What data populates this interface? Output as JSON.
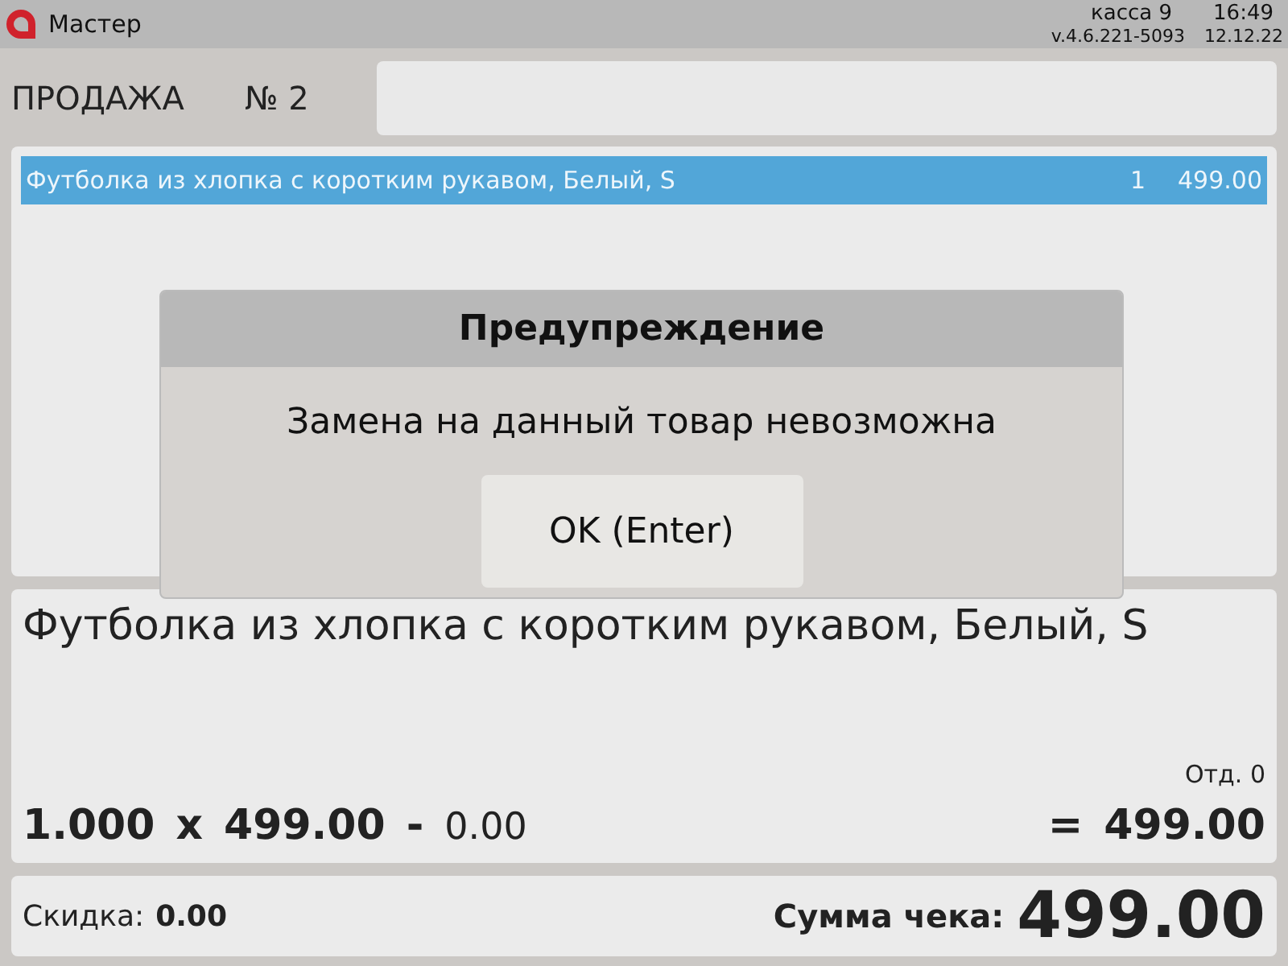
{
  "top_bar": {
    "app_name": "Мастер",
    "register": "касса 9",
    "time": "16:49",
    "version": "v.4.6.221-5093",
    "date": "12.12.22"
  },
  "sale": {
    "title": "ПРОДАЖА",
    "number": "№ 2"
  },
  "receipt_rows": [
    {
      "name": "Футболка из хлопка с коротким рукавом, Белый, S",
      "quantity": "1",
      "price": "499.00",
      "selected": true
    }
  ],
  "current_item": {
    "name": "Футболка из хлопка с коротким рукавом, Белый, S",
    "department": "Отд. 0",
    "quantity": "1.000",
    "times": "x",
    "price": "499.00",
    "minus": "-",
    "discount": "0.00",
    "equals": "=",
    "total": "499.00"
  },
  "totals": {
    "discount_label": "Скидка:",
    "discount": "0.00",
    "sum_label": "Сумма чека:",
    "sum": "499.00"
  },
  "dialog": {
    "title": "Предупреждение",
    "message": "Замена на данный товар невозможна",
    "button": "OK (Enter)"
  }
}
